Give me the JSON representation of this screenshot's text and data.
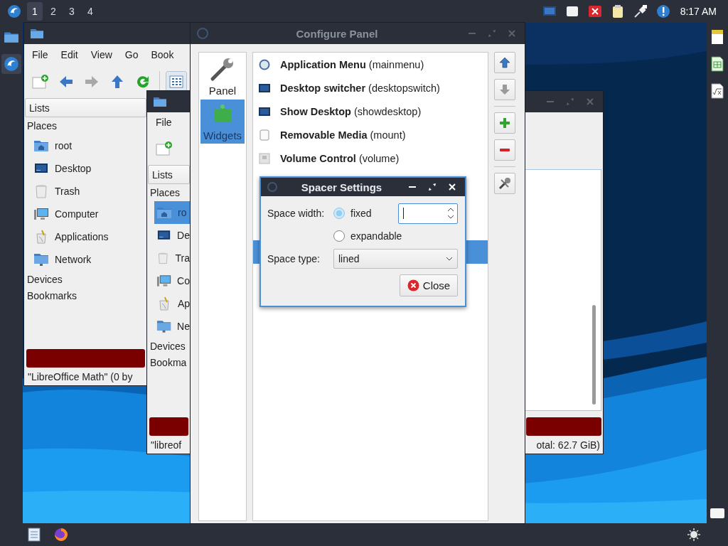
{
  "top_panel": {
    "workspaces": [
      {
        "label": "1",
        "selected": true
      },
      {
        "label": "2",
        "selected": false
      },
      {
        "label": "3",
        "selected": false
      },
      {
        "label": "4",
        "selected": false
      }
    ],
    "clock": "8:17 AM"
  },
  "file_manager_back": {
    "menu": [
      "File",
      "Edit",
      "View",
      "Go",
      "Book"
    ],
    "side_pane_mode": "Lists",
    "places_heading": "Places",
    "places": [
      {
        "label": "root",
        "kind": "home",
        "selected": false
      },
      {
        "label": "Desktop",
        "kind": "desktop",
        "selected": false
      },
      {
        "label": "Trash",
        "kind": "trash",
        "selected": false
      },
      {
        "label": "Computer",
        "kind": "computer",
        "selected": false
      },
      {
        "label": "Applications",
        "kind": "applications",
        "selected": false
      },
      {
        "label": "Network",
        "kind": "network",
        "selected": false
      }
    ],
    "sections": [
      "Devices",
      "Bookmarks"
    ],
    "status": "\"LibreOffice Math\" (0 by"
  },
  "file_manager_front": {
    "menu": [
      "File"
    ],
    "side_pane_mode": "Lists",
    "places_heading": "Places",
    "places": [
      {
        "label": "ro",
        "kind": "home",
        "selected": true
      },
      {
        "label": "De",
        "kind": "desktop",
        "selected": false
      },
      {
        "label": "Tra",
        "kind": "trash",
        "selected": false
      },
      {
        "label": "Co",
        "kind": "computer",
        "selected": false
      },
      {
        "label": "Ap",
        "kind": "applications",
        "selected": false
      },
      {
        "label": "Ne",
        "kind": "network",
        "selected": false
      }
    ],
    "sections": [
      "Devices",
      "Bookma"
    ],
    "status_left": "\"libreof",
    "status_right": "otal: 62.7 GiB)"
  },
  "configure_panel": {
    "active": false,
    "title": "Configure Panel",
    "pages": [
      {
        "label": "Panel",
        "kind": "panel",
        "selected": false
      },
      {
        "label": "Widgets",
        "kind": "widgets",
        "selected": true
      }
    ],
    "widgets": [
      {
        "label": "**Application Menu** (mainmenu)",
        "kind": "menu",
        "selected": false
      },
      {
        "label": "**Desktop switcher** (desktopswitch)",
        "kind": "switcher",
        "selected": false
      },
      {
        "label": "**Show Desktop** (showdesktop)",
        "kind": "desktop",
        "selected": false
      },
      {
        "label": "**Removable Media** (mount)",
        "kind": "mount",
        "selected": false
      },
      {
        "label": "**Volume Control** (volume)",
        "kind": "volume",
        "selected": false
      },
      {
        "selected": false
      },
      {
        "selected": false
      },
      {
        "selected": false
      },
      {
        "selected": true
      }
    ],
    "actions": [
      [
        {
          "kind": "up",
          "disabled": false
        },
        {
          "kind": "down",
          "disabled": true
        }
      ],
      [
        {
          "kind": "add",
          "disabled": false
        },
        {
          "kind": "remove",
          "disabled": false
        }
      ],
      [
        {
          "kind": "configure",
          "disabled": false
        }
      ]
    ]
  },
  "spacer_settings": {
    "active": true,
    "title": "Spacer Settings",
    "width_label": "Space width:",
    "width_modes": [
      {
        "label": "fixed",
        "selected": true
      },
      {
        "label": "expandable",
        "selected": false
      }
    ],
    "type_label": "Space type:",
    "type_value": "lined",
    "close": "Close"
  }
}
